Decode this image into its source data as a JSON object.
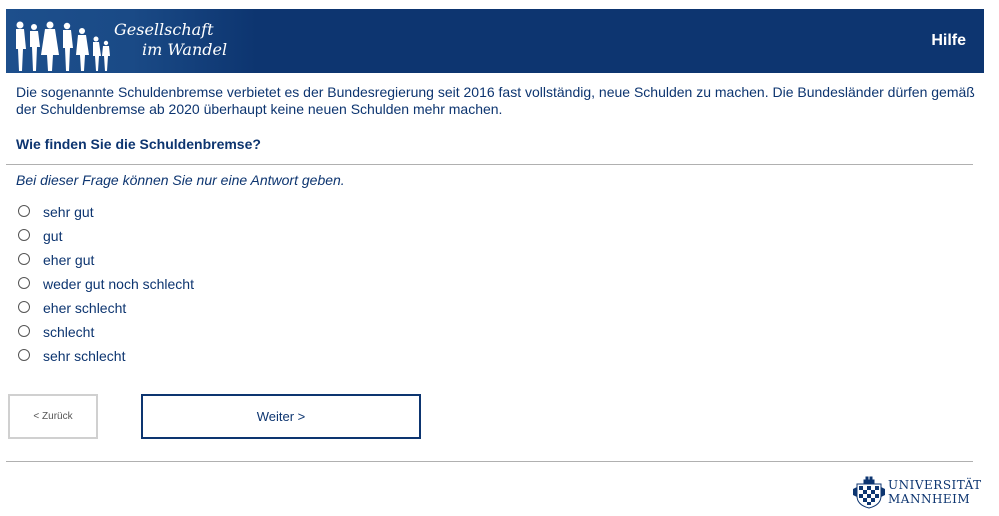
{
  "header": {
    "logo_line1": "Gesellschaft",
    "logo_line2": "im Wandel",
    "help_label": "Hilfe"
  },
  "intro_text": "Die sogenannte Schuldenbremse verbietet es der Bundesregierung seit 2016 fast vollständig, neue Schulden zu machen. Die Bundesländer dürfen gemäß der Schuldenbremse ab 2020 überhaupt keine neuen Schulden mehr machen.",
  "question": "Wie finden Sie die Schuldenbremse?",
  "hint": "Bei dieser Frage können Sie nur eine Antwort geben.",
  "options": [
    {
      "label": "sehr gut"
    },
    {
      "label": "gut"
    },
    {
      "label": "eher gut"
    },
    {
      "label": "weder gut noch schlecht"
    },
    {
      "label": "eher schlecht"
    },
    {
      "label": "schlecht"
    },
    {
      "label": "sehr schlecht"
    }
  ],
  "navigation": {
    "back_label": "< Zurück",
    "next_label": "Weiter >"
  },
  "footer": {
    "uni_line1": "UNIVERSITÄT",
    "uni_line2": "MANNHEIM"
  },
  "colors": {
    "brand": "#0d3570",
    "divider": "#b0b0b0"
  }
}
